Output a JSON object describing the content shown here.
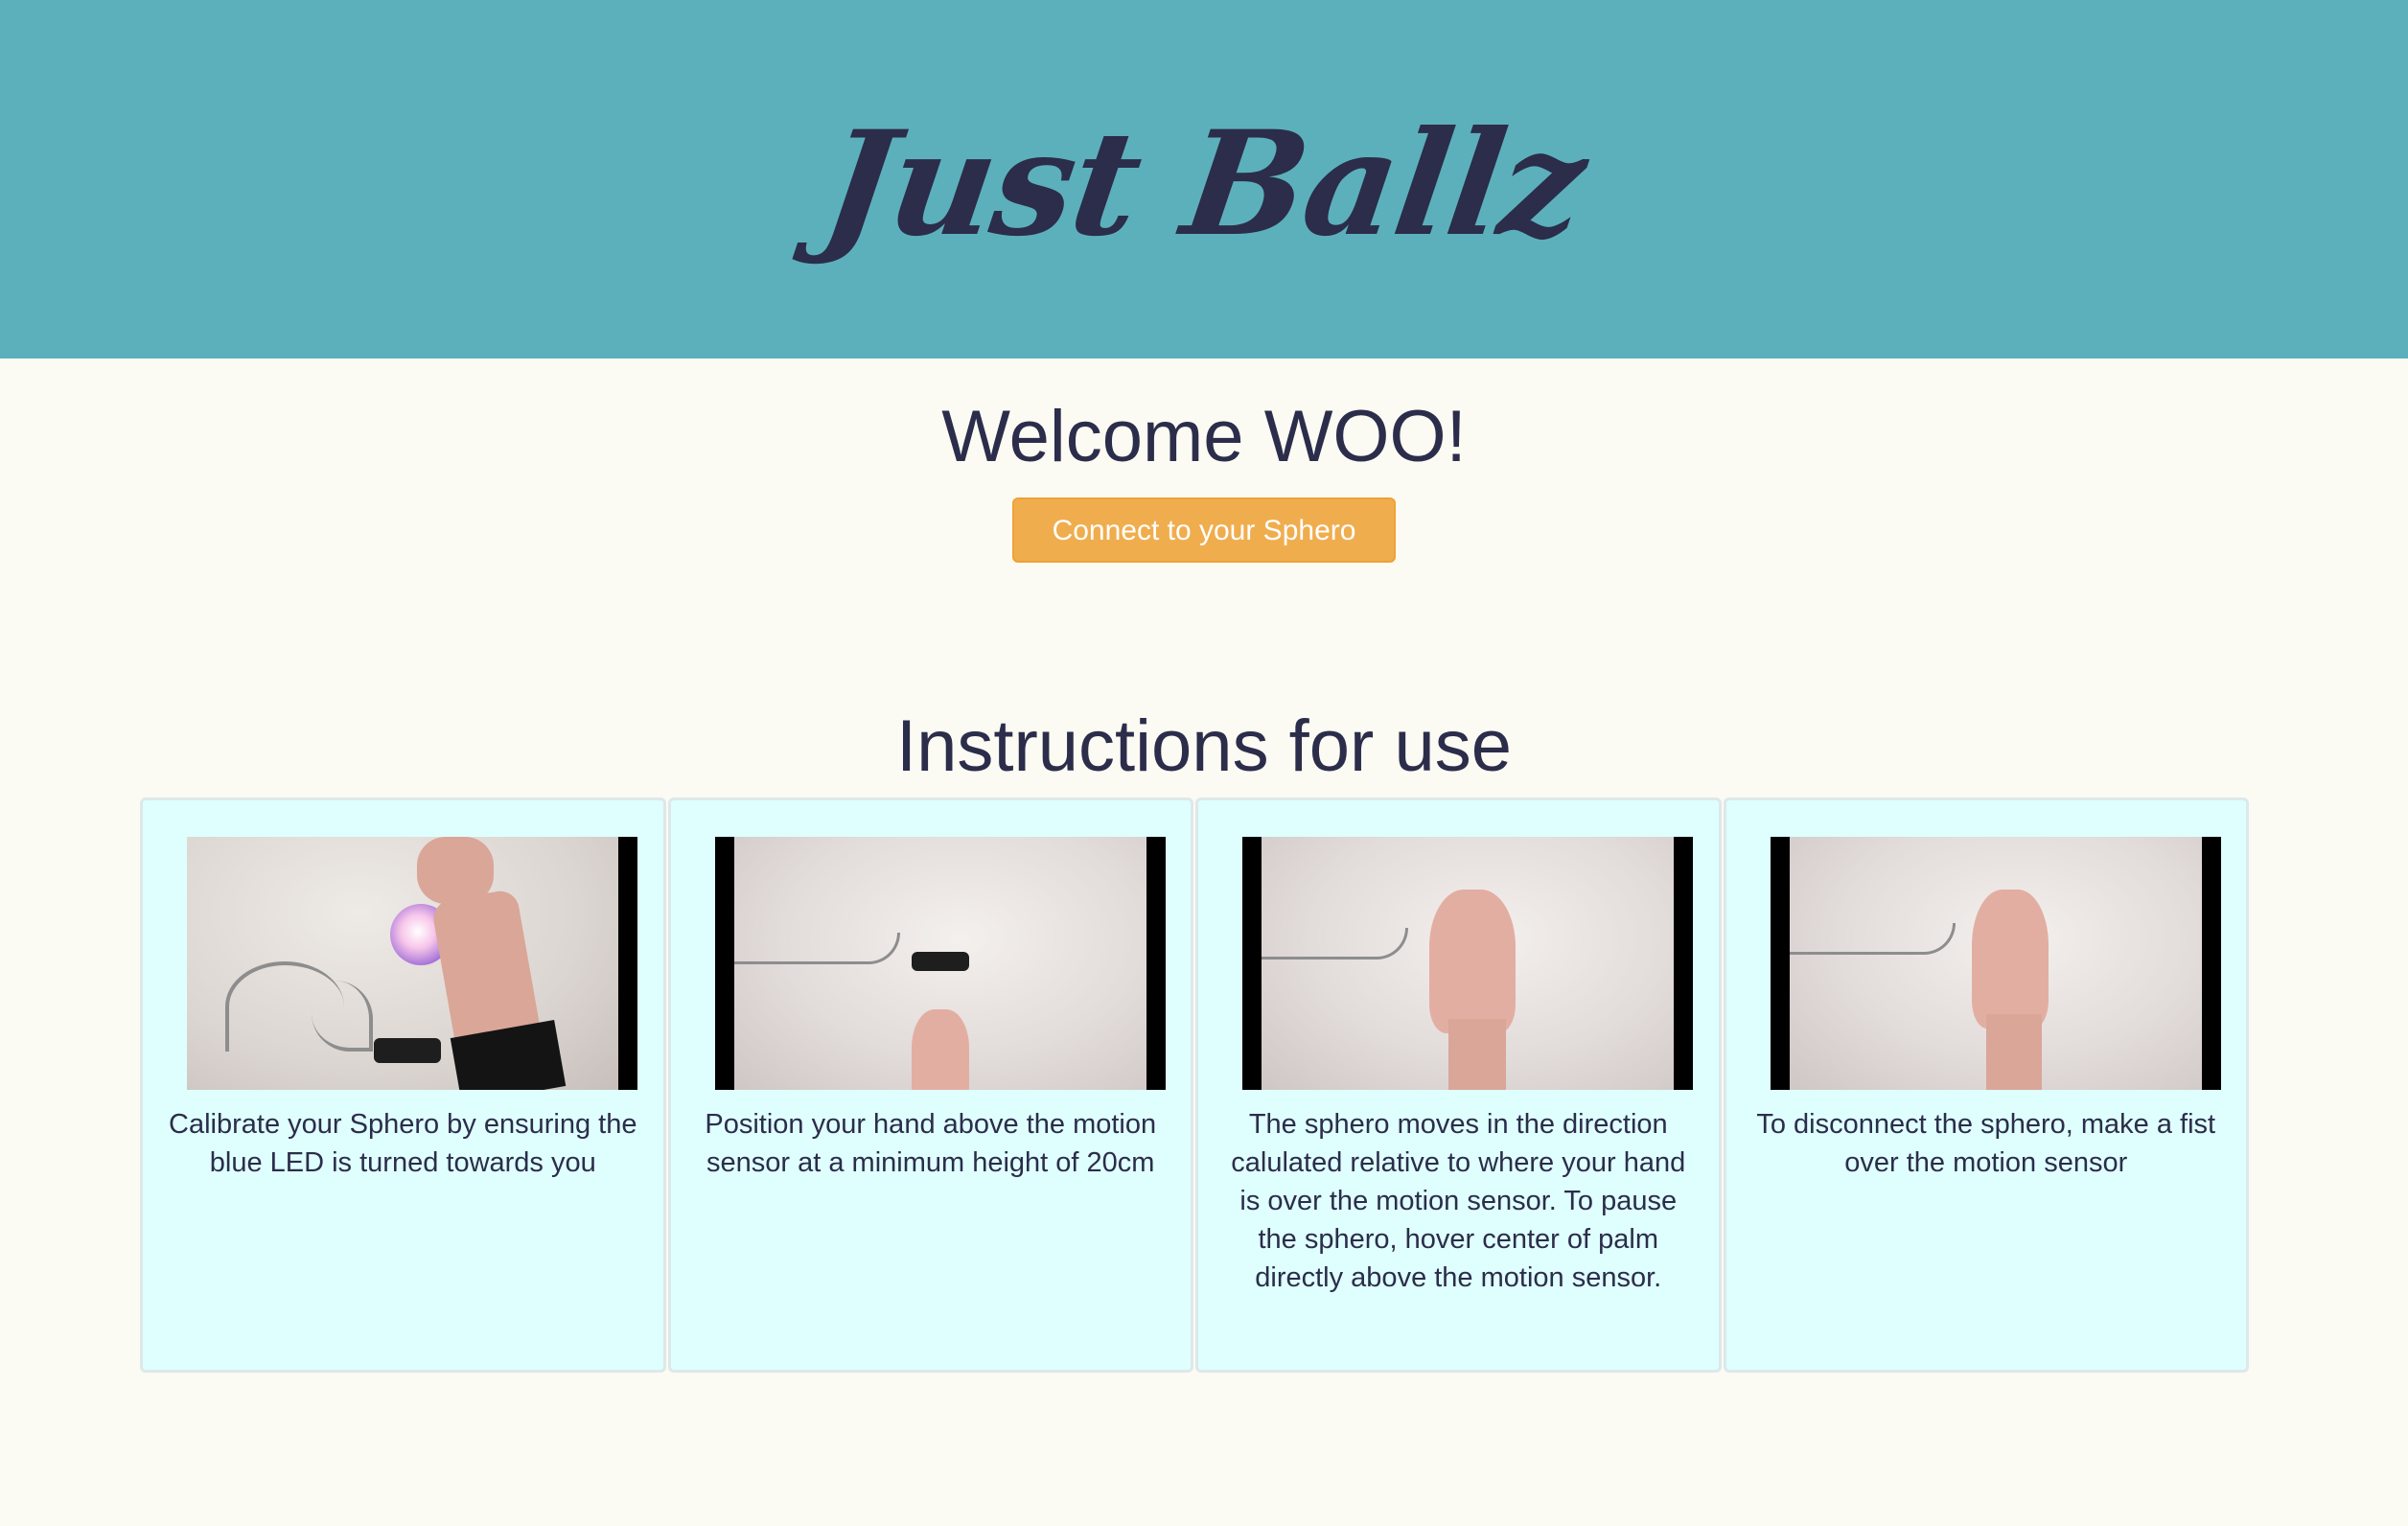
{
  "header": {
    "logo_text": "Just Ballz"
  },
  "main": {
    "welcome_heading": "Welcome WOO!",
    "connect_button_label": "Connect to your Sphero",
    "instructions_heading": "Instructions for use",
    "steps": [
      {
        "caption": "Calibrate your Sphero by ensuring the blue LED is turned towards you"
      },
      {
        "caption": "Position your hand above the motion sensor at a minimum height of 20cm"
      },
      {
        "caption": "The sphero moves in the direction calulated relative to where your hand is over the motion sensor. To pause the sphero, hover center of palm directly above the motion sensor."
      },
      {
        "caption": "To disconnect the sphero, make a fist over the motion sensor"
      }
    ]
  },
  "colors": {
    "header_bg": "#5cb0bb",
    "page_bg": "#fbfaf3",
    "text": "#2b2d4a",
    "button_bg": "#f0ad4e",
    "card_bg": "#dffffe"
  }
}
